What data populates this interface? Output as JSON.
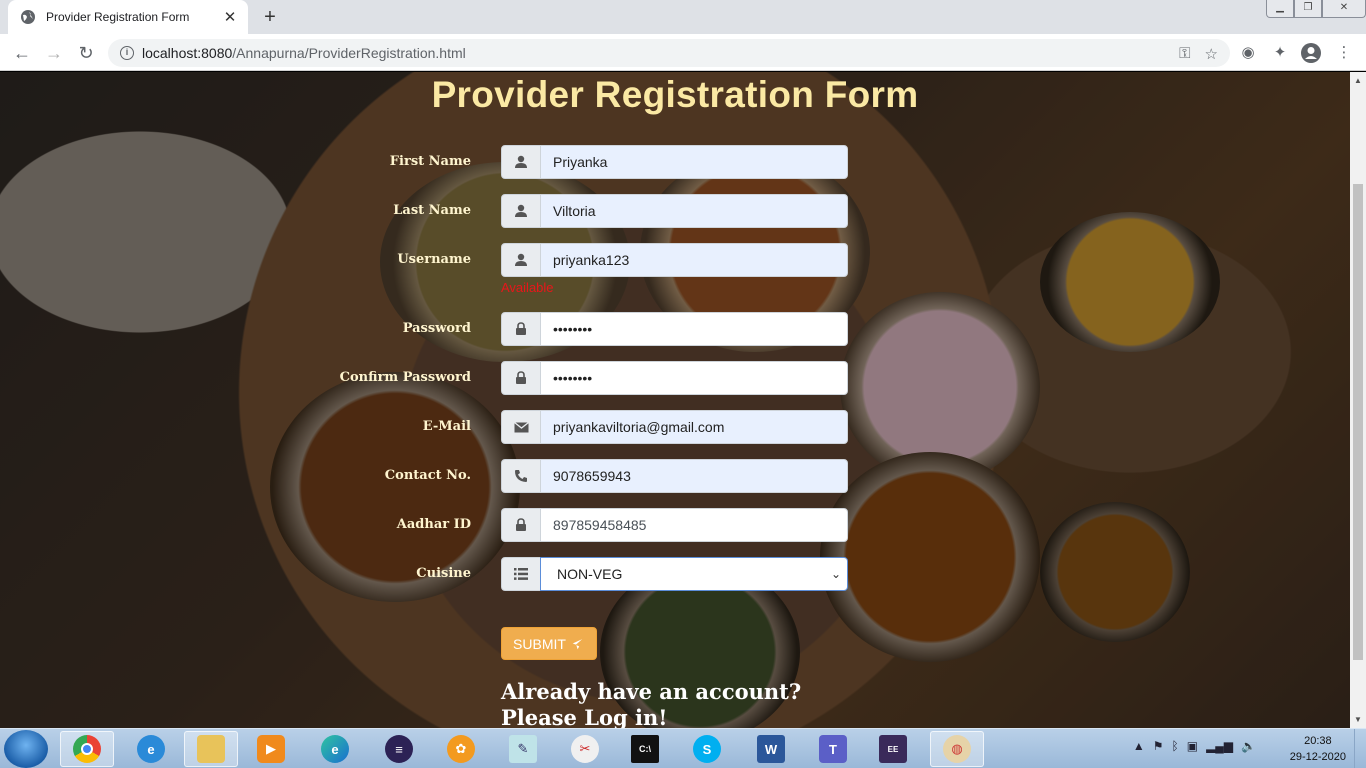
{
  "browser": {
    "tab_title": "Provider Registration Form",
    "tab_close": "✕",
    "new_tab": "+",
    "url_host": "localhost:8080",
    "url_path": "/Annapurna/ProviderRegistration.html"
  },
  "page": {
    "title": "Provider Registration Form",
    "fields": [
      {
        "label": "First Name",
        "icon": "user-icon",
        "value": "Priyanka"
      },
      {
        "label": "Last Name",
        "icon": "user-icon",
        "value": "Viltoria"
      },
      {
        "label": "Username",
        "icon": "user-icon",
        "value": "priyanka123"
      },
      {
        "label": "Password",
        "icon": "lock-icon",
        "value": "••••••••"
      },
      {
        "label": "Confirm Password",
        "icon": "lock-icon",
        "value": "••••••••"
      },
      {
        "label": "E-Mail",
        "icon": "envelope-icon",
        "value": "priyankaviltoria@gmail.com"
      },
      {
        "label": "Contact No.",
        "icon": "phone-icon",
        "value": "9078659943"
      },
      {
        "label": "Aadhar ID",
        "icon": "lock-icon",
        "value": "897859458485"
      },
      {
        "label": "Cuisine",
        "icon": "list-icon",
        "value": "NON-VEG"
      }
    ],
    "username_status": "Available",
    "username_status_color": "#e8161a",
    "submit_label": "SUBMIT",
    "login_text": "Already have an account?Please Log in!"
  },
  "taskbar": {
    "time": "20:38",
    "date": "29-12-2020"
  },
  "colors": {
    "title": "#fbe9a4",
    "submit": "#f0ad4e",
    "autofill": "#e8f0fe"
  }
}
